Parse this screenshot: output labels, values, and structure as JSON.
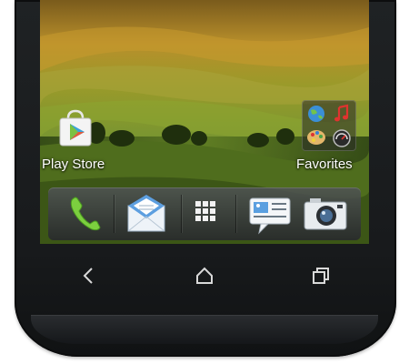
{
  "home": {
    "shortcuts": [
      {
        "label": "Play Store",
        "icon": "play-store-icon"
      },
      {
        "label": "Favorites",
        "icon": "folder-icon"
      }
    ]
  },
  "favorites_folder_icons": [
    "browser-globe-icon",
    "music-icon",
    "paint-palette-icon",
    "speedometer-icon"
  ],
  "dock": {
    "items": [
      {
        "icon": "phone-icon"
      },
      {
        "icon": "mail-icon"
      },
      {
        "icon": "app-drawer-grid-icon"
      },
      {
        "icon": "messages-icon"
      },
      {
        "icon": "camera-icon"
      }
    ]
  },
  "nav": {
    "buttons": [
      {
        "icon": "back-icon"
      },
      {
        "icon": "home-icon"
      },
      {
        "icon": "recent-apps-icon"
      }
    ]
  },
  "colors": {
    "phone_body": "#1b1d1f",
    "nav_icons": "#d9d9d9",
    "wallpaper_field": "#6e8a27",
    "wallpaper_sky": "#b88f2b"
  }
}
